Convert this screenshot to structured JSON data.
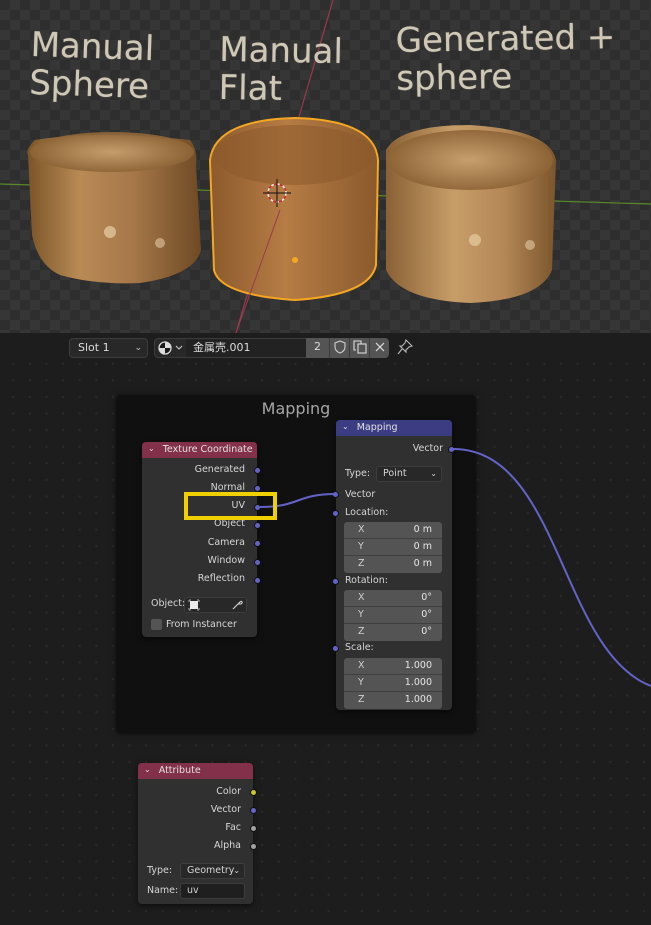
{
  "viewport": {
    "labels": [
      {
        "id": "left",
        "text": "Manual\nSphere"
      },
      {
        "id": "middle",
        "text": "Manual\nFlat"
      },
      {
        "id": "right",
        "text": "Generated +\nsphere"
      }
    ],
    "objects": [
      "cup-left",
      "cup-middle-selected",
      "cup-right"
    ],
    "colors": {
      "selection_outline": "#f5a623",
      "x_axis": "#9a3a4e",
      "y_axis": "#5a8a2a",
      "cup_base": "#b5874f"
    }
  },
  "header": {
    "slot_label": "Slot 1",
    "material_name": "金属壳.001",
    "user_count": "2",
    "icons": [
      "material-sphere-icon",
      "chevron-down-icon",
      "fake-user-shield-icon",
      "duplicate-icon",
      "close-icon",
      "pin-icon"
    ]
  },
  "node_editor": {
    "frame": {
      "title": "Mapping"
    },
    "texture_coordinate": {
      "title": "Texture Coordinate",
      "outputs": [
        "Generated",
        "Normal",
        "UV",
        "Object",
        "Camera",
        "Window",
        "Reflection"
      ],
      "object_label": "Object:",
      "from_instancer_label": "From Instancer",
      "from_instancer_checked": false,
      "highlighted_output": "UV"
    },
    "mapping": {
      "title": "Mapping",
      "output": "Vector",
      "type_label": "Type:",
      "type_value": "Point",
      "vector_input": "Vector",
      "location": {
        "label": "Location:",
        "x": "0 m",
        "y": "0 m",
        "z": "0 m"
      },
      "rotation": {
        "label": "Rotation:",
        "x": "0°",
        "y": "0°",
        "z": "0°"
      },
      "scale": {
        "label": "Scale:",
        "x": "1.000",
        "y": "1.000",
        "z": "1.000"
      },
      "axes": [
        "X",
        "Y",
        "Z"
      ]
    },
    "attribute": {
      "title": "Attribute",
      "outputs": [
        "Color",
        "Vector",
        "Fac",
        "Alpha"
      ],
      "type_label": "Type:",
      "type_value": "Geometry",
      "name_label": "Name:",
      "name_value": "uv"
    },
    "colors": {
      "input_header": "#83314a",
      "vector_header": "#3c3c83",
      "vector_socket": "#6363c7",
      "color_socket": "#c7c729",
      "float_socket": "#a1a1a1",
      "highlight": "#f0d000"
    }
  }
}
